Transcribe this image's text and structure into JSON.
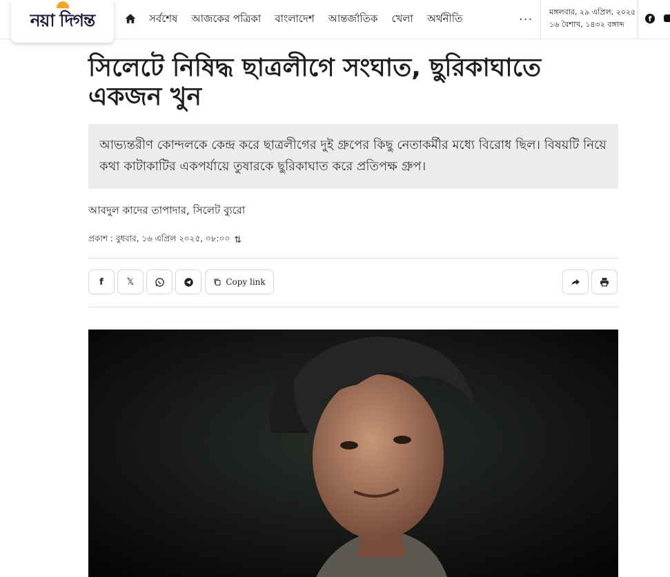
{
  "header": {
    "logo_text": "নয়া দিগন্ত",
    "nav": [
      "সর্বশেষ",
      "আজকের পত্রিকা",
      "বাংলাদেশ",
      "আন্তর্জাতিক",
      "খেলা",
      "অর্থনীতি"
    ],
    "more_label": "···",
    "date_bn": "মঙ্গলবার, ২৯ এপ্রিল, ২০২৫",
    "date_bangla_calendar": "১৬ বৈশাখ, ১৪৩২ বঙ্গাব্দ"
  },
  "article": {
    "headline": "সিলেটে নিষিদ্ধ ছাত্রলীগে সংঘাত, ছুরিকাঘাতে একজন খুন",
    "summary": "আভ্যন্তরীণ কোন্দলকে কেন্দ্র করে ছাত্রলীগের দুই গ্রুপের কিছু নেতাকর্মীর মধ্যে বিরোধ ছিল। বিষয়টি নিয়ে কথা কাটাকাটির একপর্যায়ে তুষারকে ছুরিকাঘাত করে প্রতিপক্ষ গ্রুপ।",
    "byline": "আবদুল কাদের তাপাদার, সিলেট ব্যুরো",
    "published": "প্রকাশ : বুধবার, ১৬ এপ্রিল ২০২৫, ০৮:০০"
  },
  "share": {
    "facebook": "f",
    "x": "𝕏",
    "copy_label": "Copy link"
  },
  "icons": {
    "home": "home-icon",
    "facebook": "facebook-icon",
    "x": "x-icon",
    "whatsapp": "whatsapp-icon",
    "telegram": "telegram-icon",
    "copy": "copy-icon",
    "share": "share-icon",
    "print": "print-icon",
    "sort": "sort-icon"
  },
  "colors": {
    "summary_bg": "#ececec",
    "headline": "#1e1e1e",
    "logo_accent": "#f6a623"
  }
}
